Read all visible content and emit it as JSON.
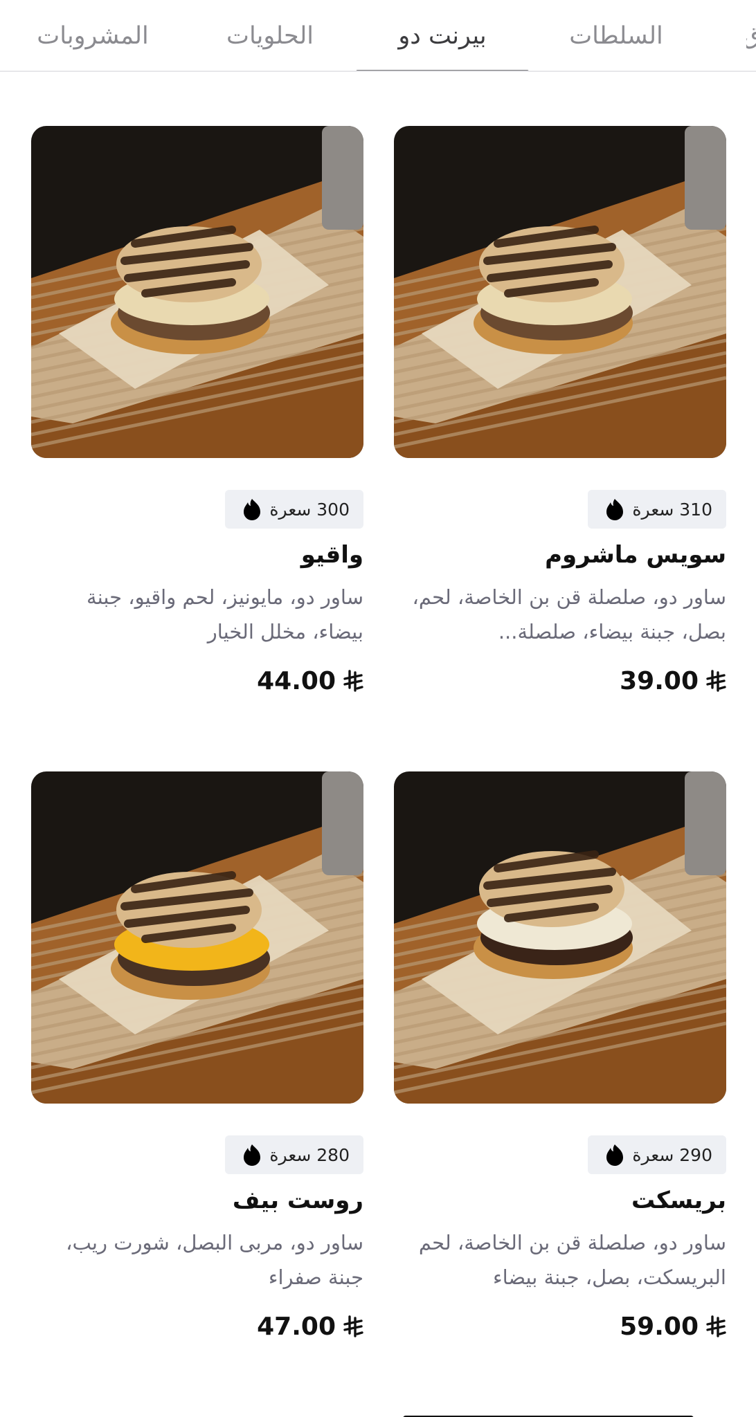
{
  "tabs": [
    {
      "label": "المشروبات",
      "active": false
    },
    {
      "label": "الحلويات",
      "active": false
    },
    {
      "label": "بيرنت دو",
      "active": true
    },
    {
      "label": "السلطات",
      "active": false
    }
  ],
  "calorie_icon": "flame-icon",
  "currency_icon": "riyal-icon",
  "items": [
    {
      "name": "سويس ماشروم",
      "calories": "310 سعرة",
      "description": "ساور دو، صلصلة قن بن الخاصة، لحم، بصل، جبنة بيضاء، صلصلة...",
      "price": "39.00",
      "image_alt": "burger-photo"
    },
    {
      "name": "واقيو",
      "calories": "300 سعرة",
      "description": "ساور دو، مايونيز، لحم واقيو، جبنة بيضاء، مخلل الخيار",
      "price": "44.00",
      "image_alt": "burger-photo"
    },
    {
      "name": "بريسكت",
      "calories": "290 سعرة",
      "description": "ساور دو، صلصلة قن بن الخاصة، لحم البريسكت، بصل، جبنة بيضاء",
      "price": "59.00",
      "image_alt": "burger-photo"
    },
    {
      "name": "روست بيف",
      "calories": "280 سعرة",
      "description": "ساور دو، مربى البصل، شورت ريب، جبنة صفراء",
      "price": "47.00",
      "image_alt": "burger-photo"
    }
  ]
}
